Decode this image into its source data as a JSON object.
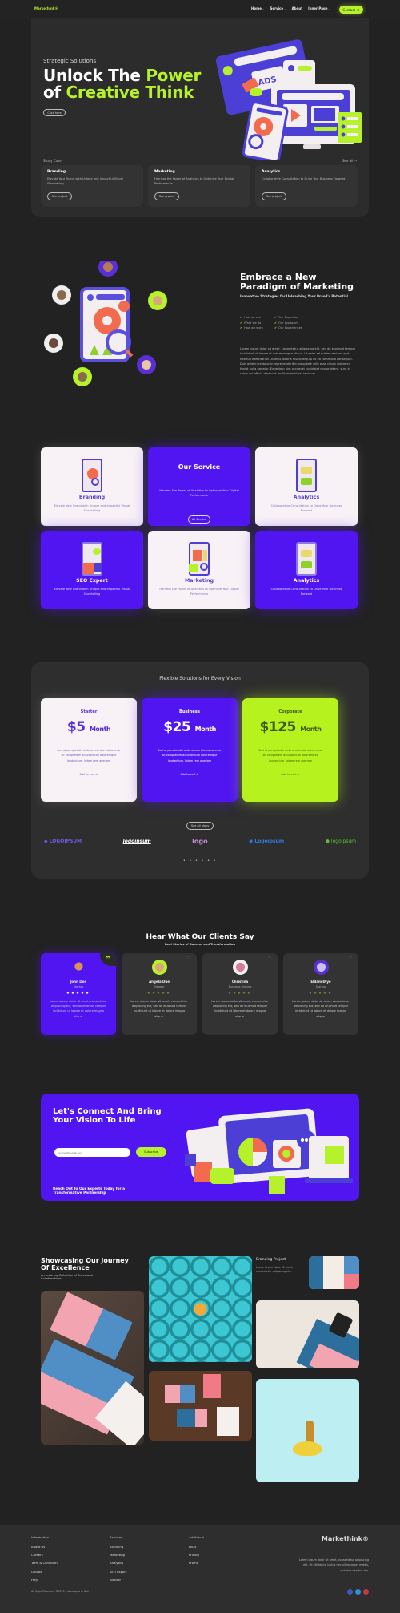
{
  "brand": {
    "name": "Markethink®",
    "accent": "#b6f22b",
    "purple": "#5015f0"
  },
  "nav": {
    "items": [
      {
        "label": "Home",
        "dropdown": true
      },
      {
        "label": "Service",
        "dropdown": true
      },
      {
        "label": "About",
        "dropdown": false
      },
      {
        "label": "Inner Page",
        "dropdown": true
      }
    ],
    "contact_label": "Contact"
  },
  "hero": {
    "kicker": "Strategic Solutions",
    "title_line1_a": "Unlock The ",
    "title_line1_b": "Power",
    "title_line2_a": "of ",
    "title_line2_b": "Creative Think",
    "cta_label": "Click here",
    "study_label": "Study Case",
    "see_all_label": "See all ⇾",
    "study_cards": [
      {
        "title": "Branding",
        "desc": "Elevate Your Brand with Unique and Impactful Visual Storytelling",
        "button": "See project"
      },
      {
        "title": "Marketing",
        "desc": "Harness the Power of Analytics to Optimize Your Digital Performance",
        "button": "See project"
      },
      {
        "title": "Analytics",
        "desc": "Collaborative Consultation to Drive Your Business Forward",
        "button": "See project"
      }
    ]
  },
  "embrace": {
    "title": "Embrace a New Paradigm of Marketing",
    "subtitle": "Innovative Strategies for Unleashing Your Brand's Potential",
    "checks": [
      "How we are",
      "Our Expertise",
      "What we do",
      "Our Approach",
      "How we work",
      "Our Experiences"
    ],
    "body": "Lorem ipsum dolor sit amet, consectetur adipiscing elit, sed do eiusmod tempor incididunt ut labore et dolore magna aliqua. Ut enim ad minim veniam, quis nostrud exercitation ullamco laboris nisi ut aliquip ex ea commodo consequat. Duis aute irure dolor in reprehenderit in voluptate velit esse cillum dolore eu fugiat nulla pariatur. Excepteur sint occaecat cupidatat non proident, sunt in culpa qui officia deserunt mollit anim id est laborum."
  },
  "services": {
    "heading": "Our Service",
    "heading_desc": "Harness the Power of Analytics to Optimize Your Digital Performance",
    "all_label": "All Service",
    "cards": [
      {
        "title": "Branding",
        "desc": "Elevate Your Brand with Unique and Impactful Visual Storytelling",
        "theme": "light"
      },
      {
        "title": "Analytics",
        "desc": "Collaborative Consultation to Drive Your Business Forward",
        "theme": "light"
      },
      {
        "title": "SEO Expert",
        "desc": "Elevate Your Brand with Unique and Impactful Visual Storytelling",
        "theme": "purple"
      },
      {
        "title": "Marketing",
        "desc": "Harness the Power of Analytics to Optimize Your Digital Performance",
        "theme": "light"
      },
      {
        "title": "Analytics",
        "desc": "Collaborative Consultation to Drive Your Business Forward",
        "theme": "purple"
      }
    ]
  },
  "pricing": {
    "title": "Flexible Solutions for Every Vision",
    "plans": [
      {
        "name": "Starter",
        "price": "$5",
        "period": "Month",
        "desc": "Sed ut perspiciatis unde omnis iste natus error sit voluptatem accusantium doloremque laudantium, totam rem aperiam",
        "cart": "Add to cart ⊕"
      },
      {
        "name": "Business",
        "price": "$25",
        "period": "Month",
        "desc": "Sed ut perspiciatis unde omnis iste natus error sit voluptatem accusantium doloremque laudantium, totam rem aperiam",
        "cart": "Add to cart ⊕"
      },
      {
        "name": "Corporate",
        "price": "$125",
        "period": "Month",
        "desc": "Sed ut perspiciatis unde omnis iste natus error sit voluptatem accusantium doloremque laudantium, totam rem aperiam",
        "cart": "Add to cart ⊕"
      }
    ],
    "see_all_label": "See all plans",
    "logos": [
      "LOGOIPSUM",
      "logoipsum",
      "logo",
      "Logoipsum",
      "logoipsum"
    ],
    "dots": "• • • • • •"
  },
  "testimonials": {
    "title": "Hear What Our Clients Say",
    "subtitle": "Real Stories of Success and Transformation",
    "items": [
      {
        "name": "John Doe",
        "role": "Startup",
        "rating": 5,
        "text": "Lorem ipsum dolor sit amet, consectetur adipiscing elit, sed do eiusmod tempor incididunt ut labore et dolore magna aliqua."
      },
      {
        "name": "Angela Due",
        "role": "Blogger",
        "rating": 5,
        "text": "Lorem ipsum dolor sit amet, consectetur adipiscing elit, sed do eiusmod tempor incididunt ut labore et dolore magna aliqua."
      },
      {
        "name": "Christina",
        "role": "Business Owners",
        "rating": 5,
        "text": "Lorem ipsum dolor sit amet, consectetur adipiscing elit, sed do eiusmod tempor incididunt ut labore et dolore magna aliqua."
      },
      {
        "name": "Eldam Øiye",
        "role": "Startup",
        "rating": 5,
        "text": "Lorem ipsum dolor sit amet, consectetur adipiscing elit, sed do eiusmod tempor incididunt ut labore et dolore magna aliqua."
      }
    ],
    "stars": "★★★★★",
    "quote_glyph": "❞"
  },
  "cta": {
    "title": "Let's Connect And Bring Your Vision To Life",
    "email_placeholder": "yourmail@domain.com",
    "subscribe_label": "Subscribe",
    "note": "Reach Out to Our Experts Today for a Transformative Partnership"
  },
  "gallery": {
    "title": "Showcasing Our Journey Of Excellence",
    "subtitle": "An Inspiring Collection of Successful Collaborations",
    "project_title": "Branding Project",
    "project_body": "Lorem ipsum dolor sit amet, consectetur adipiscing elit."
  },
  "footer": {
    "columns": [
      {
        "heading": "Information",
        "links": [
          "About Us",
          "Careers",
          "Term & Condition",
          "Update",
          "Help"
        ]
      },
      {
        "heading": "Services",
        "links": [
          "Branding",
          "Marketing",
          "Analytics",
          "SEO Export",
          "Adviser"
        ]
      },
      {
        "heading": "Additional",
        "links": [
          "FAQs",
          "Pricing",
          "Promo"
        ]
      }
    ],
    "brand": "Markethink®",
    "about": "Lorem ipsum dolor sit amet, consectetur adipiscing elit. Ut elit tellus, luctus nec ullamcorper mattis, pulvinar dapibus leo.",
    "copyright": "All Right Reserved ©2023 | developed in Bali"
  }
}
